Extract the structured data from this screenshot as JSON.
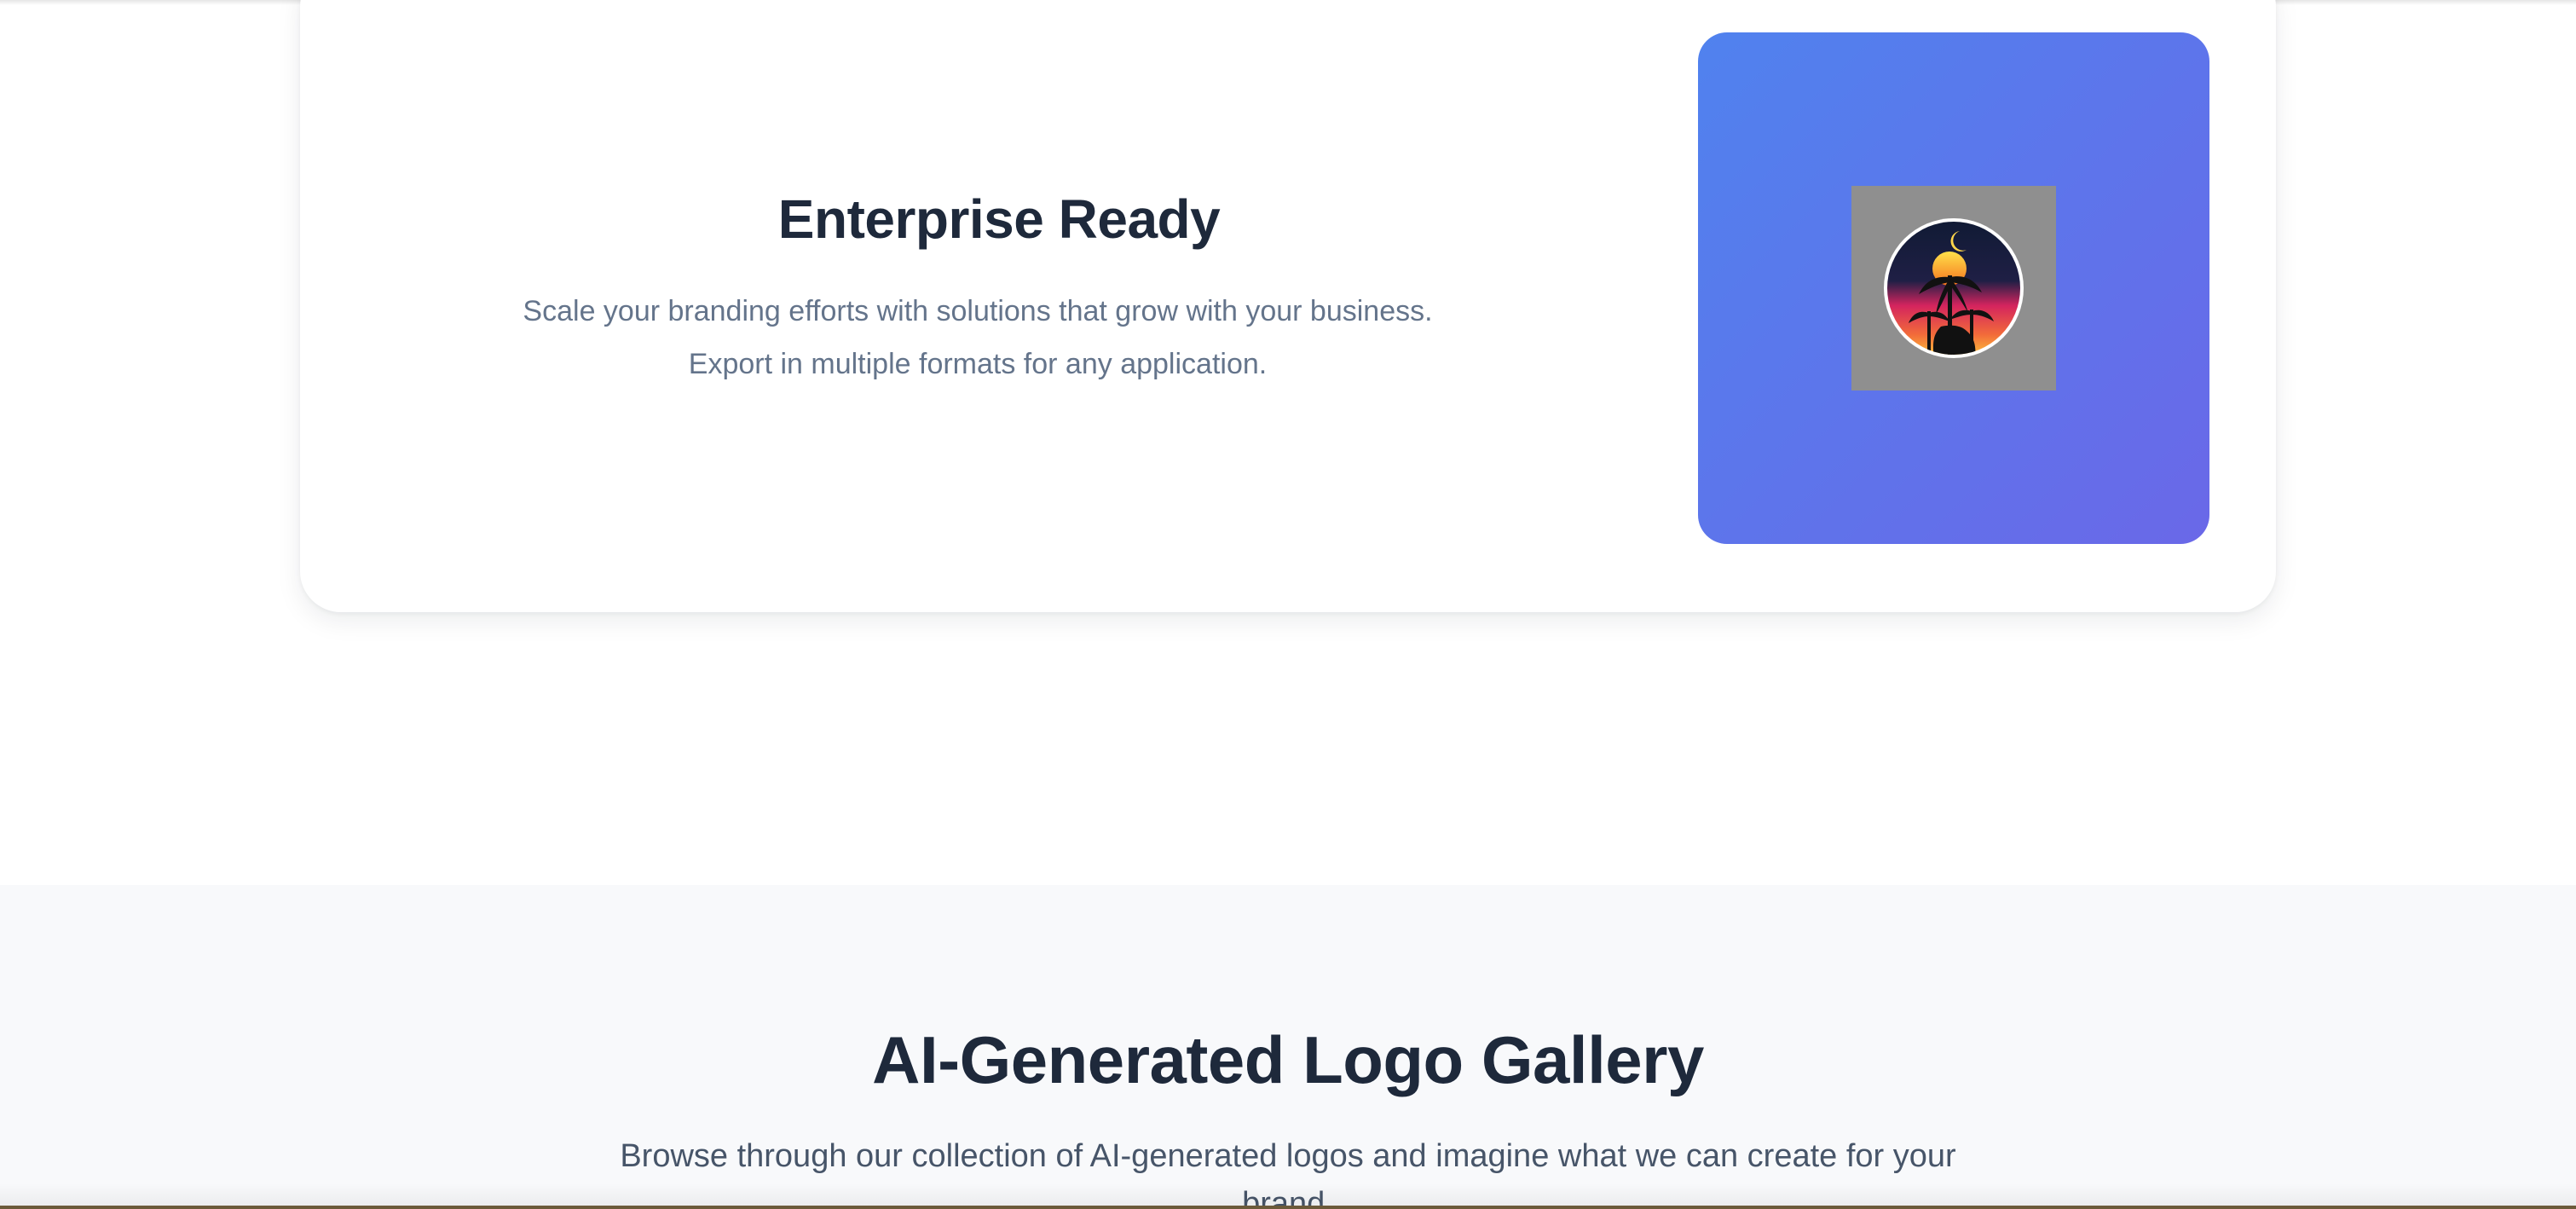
{
  "feature": {
    "title": "Enterprise Ready",
    "description": "Scale your branding efforts with solutions that grow with your business. Export in multiple formats for any application.",
    "image_icon": "sunset-palm-logo-icon"
  },
  "gallery": {
    "title": "AI-Generated Logo Gallery",
    "subtitle": "Browse through our collection of AI-generated logos and imagine what we can create for your brand."
  },
  "colors": {
    "heading": "#1e293b",
    "body_text": "#64748b",
    "gradient_start": "#5082ee",
    "gradient_end": "#6a68e8",
    "gallery_bg": "#f8f9fb"
  }
}
